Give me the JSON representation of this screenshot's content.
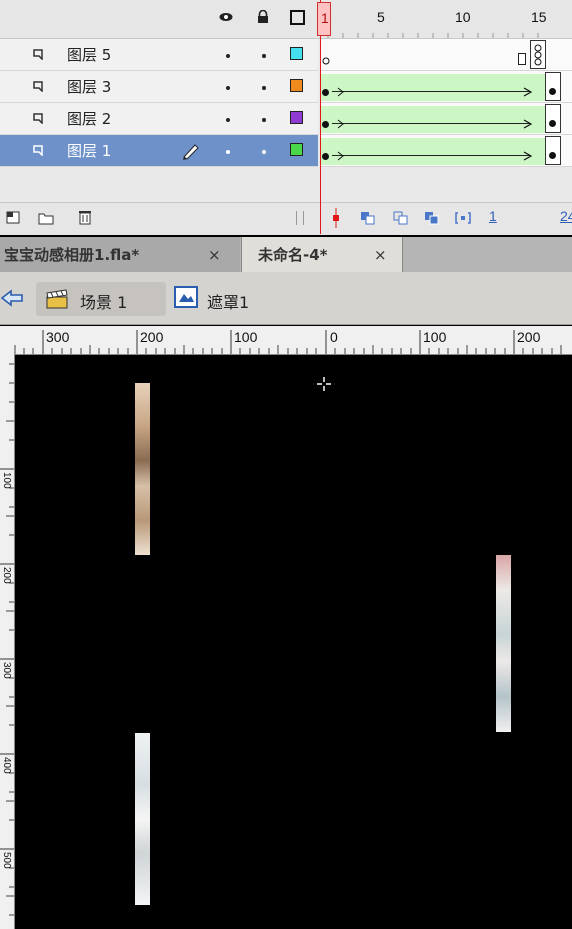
{
  "timeline": {
    "frame_numbers": [
      "1",
      "5",
      "10",
      "15"
    ],
    "layers": [
      {
        "name": "图层 5",
        "color": "#44e0ee"
      },
      {
        "name": "图层 3",
        "color": "#ee8a1e"
      },
      {
        "name": "图层 2",
        "color": "#8f3ad0"
      },
      {
        "name": "图层 1",
        "color": "#4ad84a",
        "selected": true
      }
    ],
    "footer": {
      "current_frame": "1",
      "fps": "24"
    }
  },
  "tabs": [
    {
      "label": "宝宝动感相册1.fla*",
      "close": "×"
    },
    {
      "label": "未命名-4*",
      "close": "×"
    }
  ],
  "edit_bar": {
    "scene_label": "场景 1",
    "symbol_label": "遮罩1"
  },
  "ruler": {
    "top_labels": [
      "300",
      "200",
      "100",
      "0",
      "100",
      "200"
    ],
    "left_labels": [
      "100",
      "200",
      "300",
      "400",
      "500"
    ]
  },
  "stage": {
    "background": "#000000"
  }
}
